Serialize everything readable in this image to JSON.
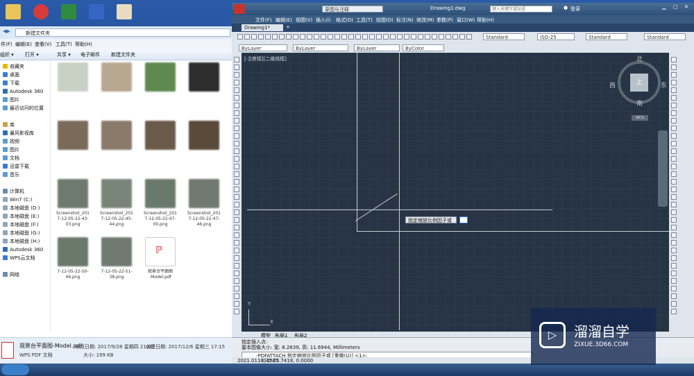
{
  "explorer": {
    "address": "新建文件夹",
    "menu": [
      "件(F)",
      "编辑(E)",
      "查看(V)",
      "工具(T)",
      "帮助(H)"
    ],
    "toolbar": [
      "组织 ▾",
      "打开 ▾",
      "共享 ▾",
      "电子邮件",
      "新建文件夹"
    ],
    "nav": [
      {
        "label": "收藏夹",
        "color": "#e6b800"
      },
      {
        "label": "桌面",
        "color": "#3b7bd1"
      },
      {
        "label": "下载",
        "color": "#3b7bd1"
      },
      {
        "label": "Autodesk 360",
        "color": "#2f6fb5"
      },
      {
        "label": "图片",
        "color": "#5a9bd8"
      },
      {
        "label": "最近访问的位置",
        "color": "#5a9bd8"
      },
      {
        "label": "",
        "color": ""
      },
      {
        "label": "库",
        "color": "#c8a24a"
      },
      {
        "label": "暴风影视库",
        "color": "#2f6fb5"
      },
      {
        "label": "视频",
        "color": "#5a9bd8"
      },
      {
        "label": "图片",
        "color": "#5a9bd8"
      },
      {
        "label": "文档",
        "color": "#5a9bd8"
      },
      {
        "label": "迅雷下载",
        "color": "#3b7bd1"
      },
      {
        "label": "音乐",
        "color": "#5a9bd8"
      },
      {
        "label": "",
        "color": ""
      },
      {
        "label": "计算机",
        "color": "#6a8cae"
      },
      {
        "label": "Win7 (C:)",
        "color": "#8fa5bb"
      },
      {
        "label": "本地磁盘 (D:)",
        "color": "#8fa5bb"
      },
      {
        "label": "本地磁盘 (E:)",
        "color": "#8fa5bb"
      },
      {
        "label": "本地磁盘 (F:)",
        "color": "#8fa5bb"
      },
      {
        "label": "本地磁盘 (G:)",
        "color": "#8fa5bb"
      },
      {
        "label": "本地磁盘 (H:)",
        "color": "#8fa5bb"
      },
      {
        "label": "Autodesk 360",
        "color": "#2f6fb5"
      },
      {
        "label": "WPS云文档",
        "color": "#3b7bd1"
      },
      {
        "label": "",
        "color": ""
      },
      {
        "label": "网络",
        "color": "#6a8cae"
      }
    ],
    "files": [
      {
        "label": "",
        "color": "#c9d0c4"
      },
      {
        "label": "",
        "color": "#b8a892"
      },
      {
        "label": "",
        "color": "#5e8a50"
      },
      {
        "label": "",
        "color": "#2d2d2d"
      },
      {
        "label": "",
        "color": "#7a6a5a"
      },
      {
        "label": "",
        "color": "#8a7a6a"
      },
      {
        "label": "",
        "color": "#6a5a4a"
      },
      {
        "label": "",
        "color": "#5a4a3a"
      },
      {
        "label": "Screenshot_201\n7-12-05-22-43-\n03.png",
        "color": "#6f7a6f"
      },
      {
        "label": "Screenshot_201\n7-12-05-22-45-\n44.png",
        "color": "#7a857a"
      },
      {
        "label": "Screenshot_201\n7-12-05-22-47-\n00.png",
        "color": "#6a7a6a"
      },
      {
        "label": "Screenshot_201\n7-12-05-22-47-\n46.png",
        "color": "#707a70"
      },
      {
        "label": "7-12-05-22-50-\n46.png",
        "color": "#6a7a6a"
      },
      {
        "label": "7-12-05-22-51-\n38.png",
        "color": "#707a70"
      },
      {
        "label": "观景台平面图\n-Model.pdf",
        "color": "pdf"
      }
    ],
    "status": {
      "filename": "观景台平面图-Model.pdf",
      "modified": "修改日期: 2017/9/28 星期四 21:09",
      "created": "创建日期: 2017/12/6 星期三 17:15",
      "type": "WPS PDF 文档",
      "size": "大小: 199 KB"
    }
  },
  "acad": {
    "title": "Drawing1.dwg",
    "workspace": "草图与注释",
    "search_placeholder": "键入关键字或短语",
    "login": "登录",
    "menu": [
      "文件(F)",
      "编辑(E)",
      "视图(V)",
      "插入(I)",
      "格式(O)",
      "工具(T)",
      "绘图(D)",
      "标注(N)",
      "修改(M)",
      "参数(P)",
      "窗口(W)",
      "帮助(H)"
    ],
    "doc_tab": "Drawing1*",
    "styles": [
      "Standard",
      "ISO-25",
      "Standard",
      "Standard"
    ],
    "layers": [
      "ByLayer",
      "ByLayer",
      "ByLayer",
      "ByColor"
    ],
    "viewport_label": "[-][俯视][二维线框]",
    "viewcube": {
      "n": "北",
      "s": "南",
      "e": "东",
      "w": "西",
      "top": "上",
      "wcs": "WCS"
    },
    "tooltip": "指定缩放比例因子或",
    "layout_tabs": [
      "模型",
      "布局1",
      "布局2"
    ],
    "cmd_lines": [
      "指定插入点:",
      "基本图像大小: 宽: 8.2639, 高: 11.6944, Millimeters"
    ],
    "cmd_prompt": "-PDFATTACH 指定缩放比例因子或 [重做(U)] <1>:",
    "coords": "2021.0118, 1503.7418, 0.0000",
    "scale": "ISO-25"
  },
  "watermark": {
    "title": "溜溜自学",
    "url": "ZIXUE.3D66.COM"
  }
}
